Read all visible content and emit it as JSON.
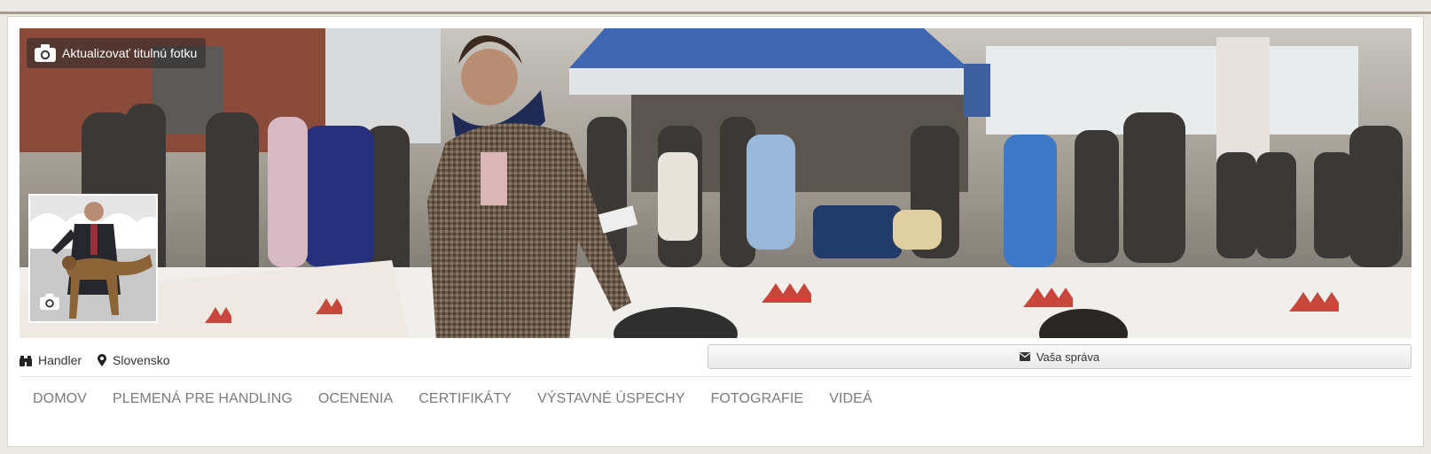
{
  "cover": {
    "update_label": "Aktualizovať titulnú fotku",
    "camera_icon": "camera-icon",
    "image_subject": "dog-show-handler-cover-photo"
  },
  "avatar": {
    "camera_icon": "camera-icon",
    "image_subject": "handler-with-dog-portrait"
  },
  "profile": {
    "role_icon": "binoculars-icon",
    "role": "Handler",
    "location_icon": "map-pin-icon",
    "location": "Slovensko"
  },
  "message_button": {
    "icon": "envelope-icon",
    "label": "Vaša správa"
  },
  "nav": {
    "tabs": [
      {
        "label": "DOMOV"
      },
      {
        "label": "PLEMENÁ PRE HANDLING"
      },
      {
        "label": "OCENENIA"
      },
      {
        "label": "CERTIFIKÁTY"
      },
      {
        "label": "VÝSTAVNÉ ÚSPECHY"
      },
      {
        "label": "FOTOGRAFIE"
      },
      {
        "label": "VIDEÁ"
      }
    ]
  },
  "colors": {
    "page_background": "#ece9e4",
    "top_accent_line": "#a89c86",
    "tab_text": "#7b7b7b",
    "royal_canin_red": "#c8463c"
  }
}
